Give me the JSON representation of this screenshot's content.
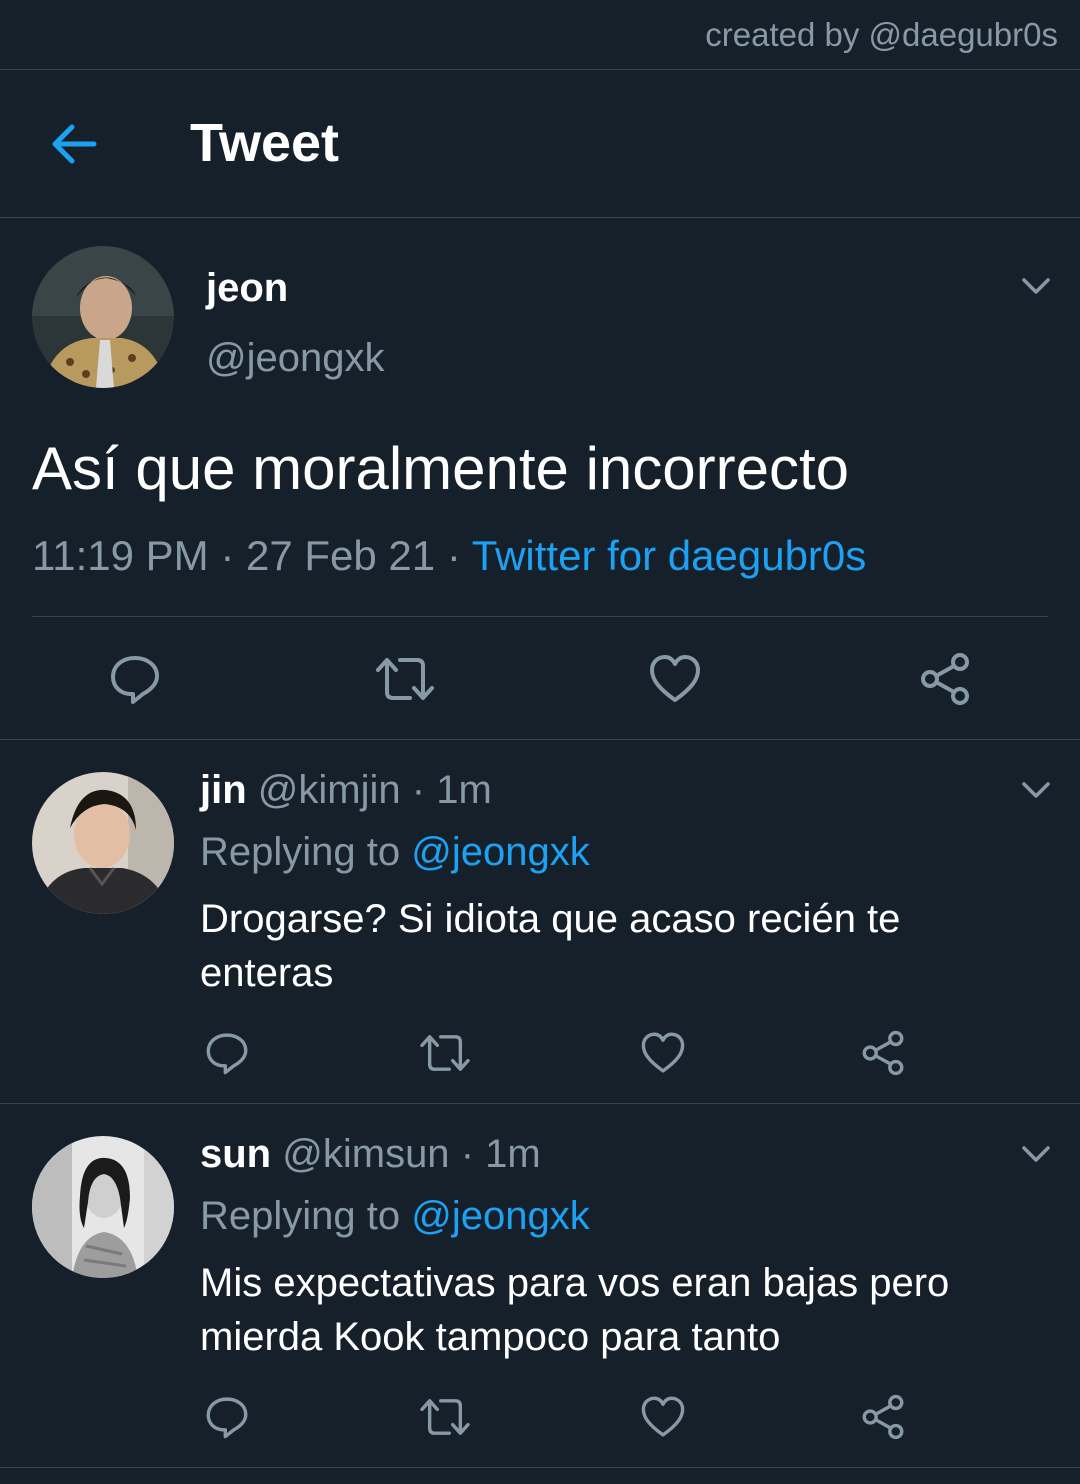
{
  "credit": "created by @daegubr0s",
  "header": {
    "title": "Tweet"
  },
  "main_tweet": {
    "name": "jeon",
    "handle": "@jeongxk",
    "text": "Así que moralmente incorrecto",
    "time": "11:19 PM",
    "date": "27 Feb 21",
    "source": "Twitter for daegubr0s",
    "sep": "·"
  },
  "replies": [
    {
      "name": "jin",
      "handle": "@kimjin",
      "age": "1m",
      "replying_label": "Replying to",
      "replying_to": "@jeongxk",
      "text_line1": "Drogarse? Si idiota que acaso recién te",
      "text_line2": "enteras"
    },
    {
      "name": "sun",
      "handle": "@kimsun",
      "age": "1m",
      "replying_label": "Replying to",
      "replying_to": "@jeongxk",
      "text_line1": "Mis expectativas para vos eran bajas pero",
      "text_line2": "mierda Kook tampoco para tanto"
    }
  ],
  "colors": {
    "background": "#15202b",
    "accent": "#1da1f2",
    "muted": "#8899a6",
    "divider": "#38444d"
  },
  "icons": [
    "back-arrow-icon",
    "chevron-down-icon",
    "reply-icon",
    "retweet-icon",
    "like-icon",
    "share-icon"
  ]
}
